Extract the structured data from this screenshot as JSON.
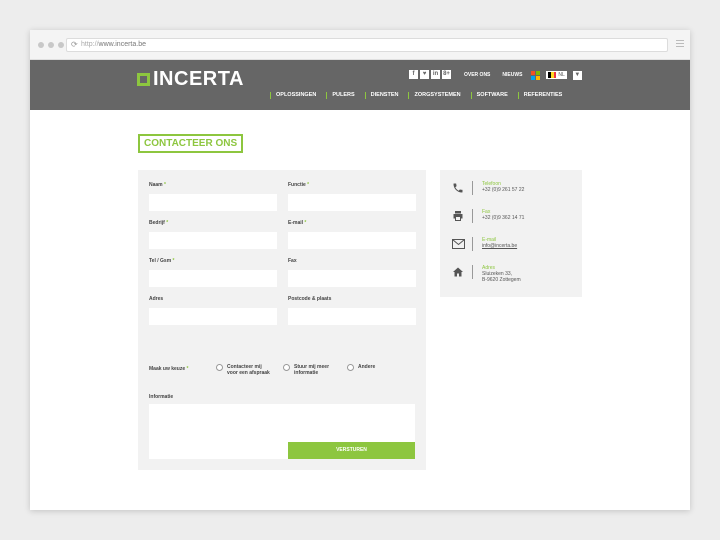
{
  "browser": {
    "url_protocol": "http://",
    "url_host": "www.incerta.be"
  },
  "header": {
    "logo": "INCERTA",
    "social": [
      "f",
      "♥",
      "in",
      "8+"
    ],
    "top_links": [
      "OVER ONS",
      "NIEUWS"
    ],
    "language": "NL",
    "nav": [
      "OPLOSSINGEN",
      "PULERS",
      "DIENSTEN",
      "ZORGSYSTEMEN",
      "SOFTWARE",
      "REFERENTIES"
    ]
  },
  "page": {
    "title": "CONTACTEER ONS"
  },
  "form": {
    "naam": "Naam",
    "functie": "Functie",
    "bedrijf": "Bedrijf",
    "email": "E-mail",
    "tel": "Tel / Gsm",
    "fax": "Fax",
    "adres": "Adres",
    "postcode": "Postcode & plaats",
    "choice_label": "Maak uw keuze",
    "required_mark": "*",
    "options": [
      "Contacteer mij voor een afspraak",
      "Stuur mij meer informatie",
      "Andere"
    ],
    "informatie": "Informatie",
    "submit": "VERSTUREN"
  },
  "contact": {
    "items": [
      {
        "icon": "phone-icon",
        "label": "Telefoon",
        "value": "+32 (0)9 261 57 22"
      },
      {
        "icon": "fax-icon",
        "label": "Fax",
        "value": "+32 (0)9 362 14 71"
      },
      {
        "icon": "mail-icon",
        "label": "E-mail",
        "value": "info@incerta.be"
      },
      {
        "icon": "home-icon",
        "label": "Adres",
        "value": "Sluizeken 33,",
        "value2": "B-9620 Zottegem"
      }
    ]
  },
  "colors": {
    "accent": "#8dc63f",
    "header_bg": "#666666",
    "panel_bg": "#f2f2f2"
  }
}
